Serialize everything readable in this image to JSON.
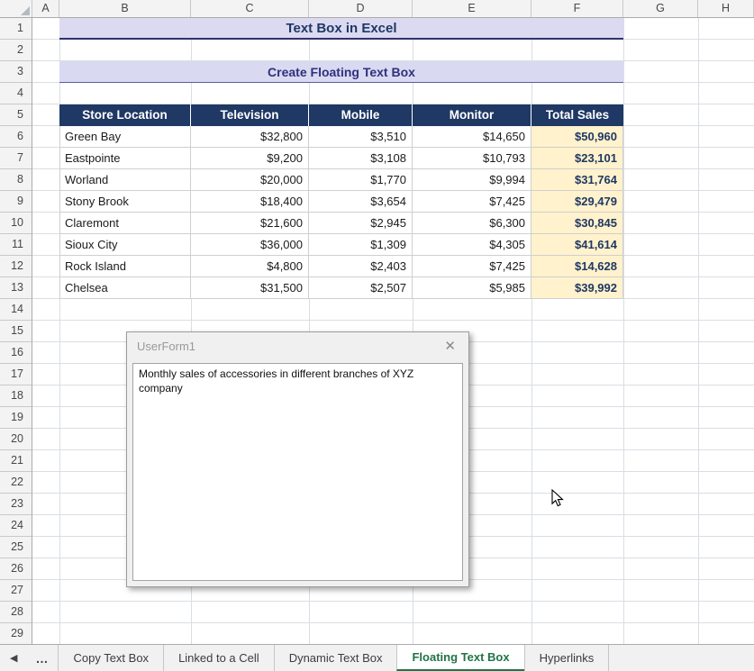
{
  "colors": {
    "navy": "#1F3864",
    "banner_bg": "#D9D9F1",
    "total_bg": "#FFF2CC",
    "active_tab_green": "#217346",
    "gridline": "#D9DEE4"
  },
  "headers": {
    "columns": [
      "A",
      "B",
      "C",
      "D",
      "E",
      "F",
      "G",
      "H"
    ],
    "rows": [
      "1",
      "2",
      "3",
      "4",
      "5",
      "6",
      "7",
      "8",
      "9",
      "10",
      "11",
      "12",
      "13",
      "14",
      "15",
      "16",
      "17",
      "18",
      "19",
      "20",
      "21",
      "22",
      "23",
      "24",
      "25",
      "26",
      "27",
      "28",
      "29"
    ]
  },
  "banners": {
    "title": "Text Box in Excel",
    "subtitle": "Create Floating Text Box"
  },
  "table": {
    "columns": [
      "Store Location",
      "Television",
      "Mobile",
      "Monitor",
      "Total Sales"
    ],
    "rows": [
      [
        "Green Bay",
        "$32,800",
        "$3,510",
        "$14,650",
        "$50,960"
      ],
      [
        "Eastpointe",
        "$9,200",
        "$3,108",
        "$10,793",
        "$23,101"
      ],
      [
        "Worland",
        "$20,000",
        "$1,770",
        "$9,994",
        "$31,764"
      ],
      [
        "Stony Brook",
        "$18,400",
        "$3,654",
        "$7,425",
        "$29,479"
      ],
      [
        "Claremont",
        "$21,600",
        "$2,945",
        "$6,300",
        "$30,845"
      ],
      [
        "Sioux City",
        "$36,000",
        "$1,309",
        "$4,305",
        "$41,614"
      ],
      [
        "Rock Island",
        "$4,800",
        "$2,403",
        "$7,425",
        "$14,628"
      ],
      [
        "Chelsea",
        "$31,500",
        "$2,507",
        "$5,985",
        "$39,992"
      ]
    ]
  },
  "userform": {
    "title": "UserForm1",
    "close_icon": "✕",
    "body_text": "Monthly sales of accessories in different branches of XYZ company"
  },
  "tab_bar": {
    "nav_prev": "◀",
    "more": "…",
    "tabs": [
      {
        "label": "Copy Text Box",
        "active": false
      },
      {
        "label": "Linked to a Cell",
        "active": false
      },
      {
        "label": "Dynamic Text Box",
        "active": false
      },
      {
        "label": "Floating Text Box",
        "active": true
      },
      {
        "label": "Hyperlinks",
        "active": false
      }
    ]
  }
}
